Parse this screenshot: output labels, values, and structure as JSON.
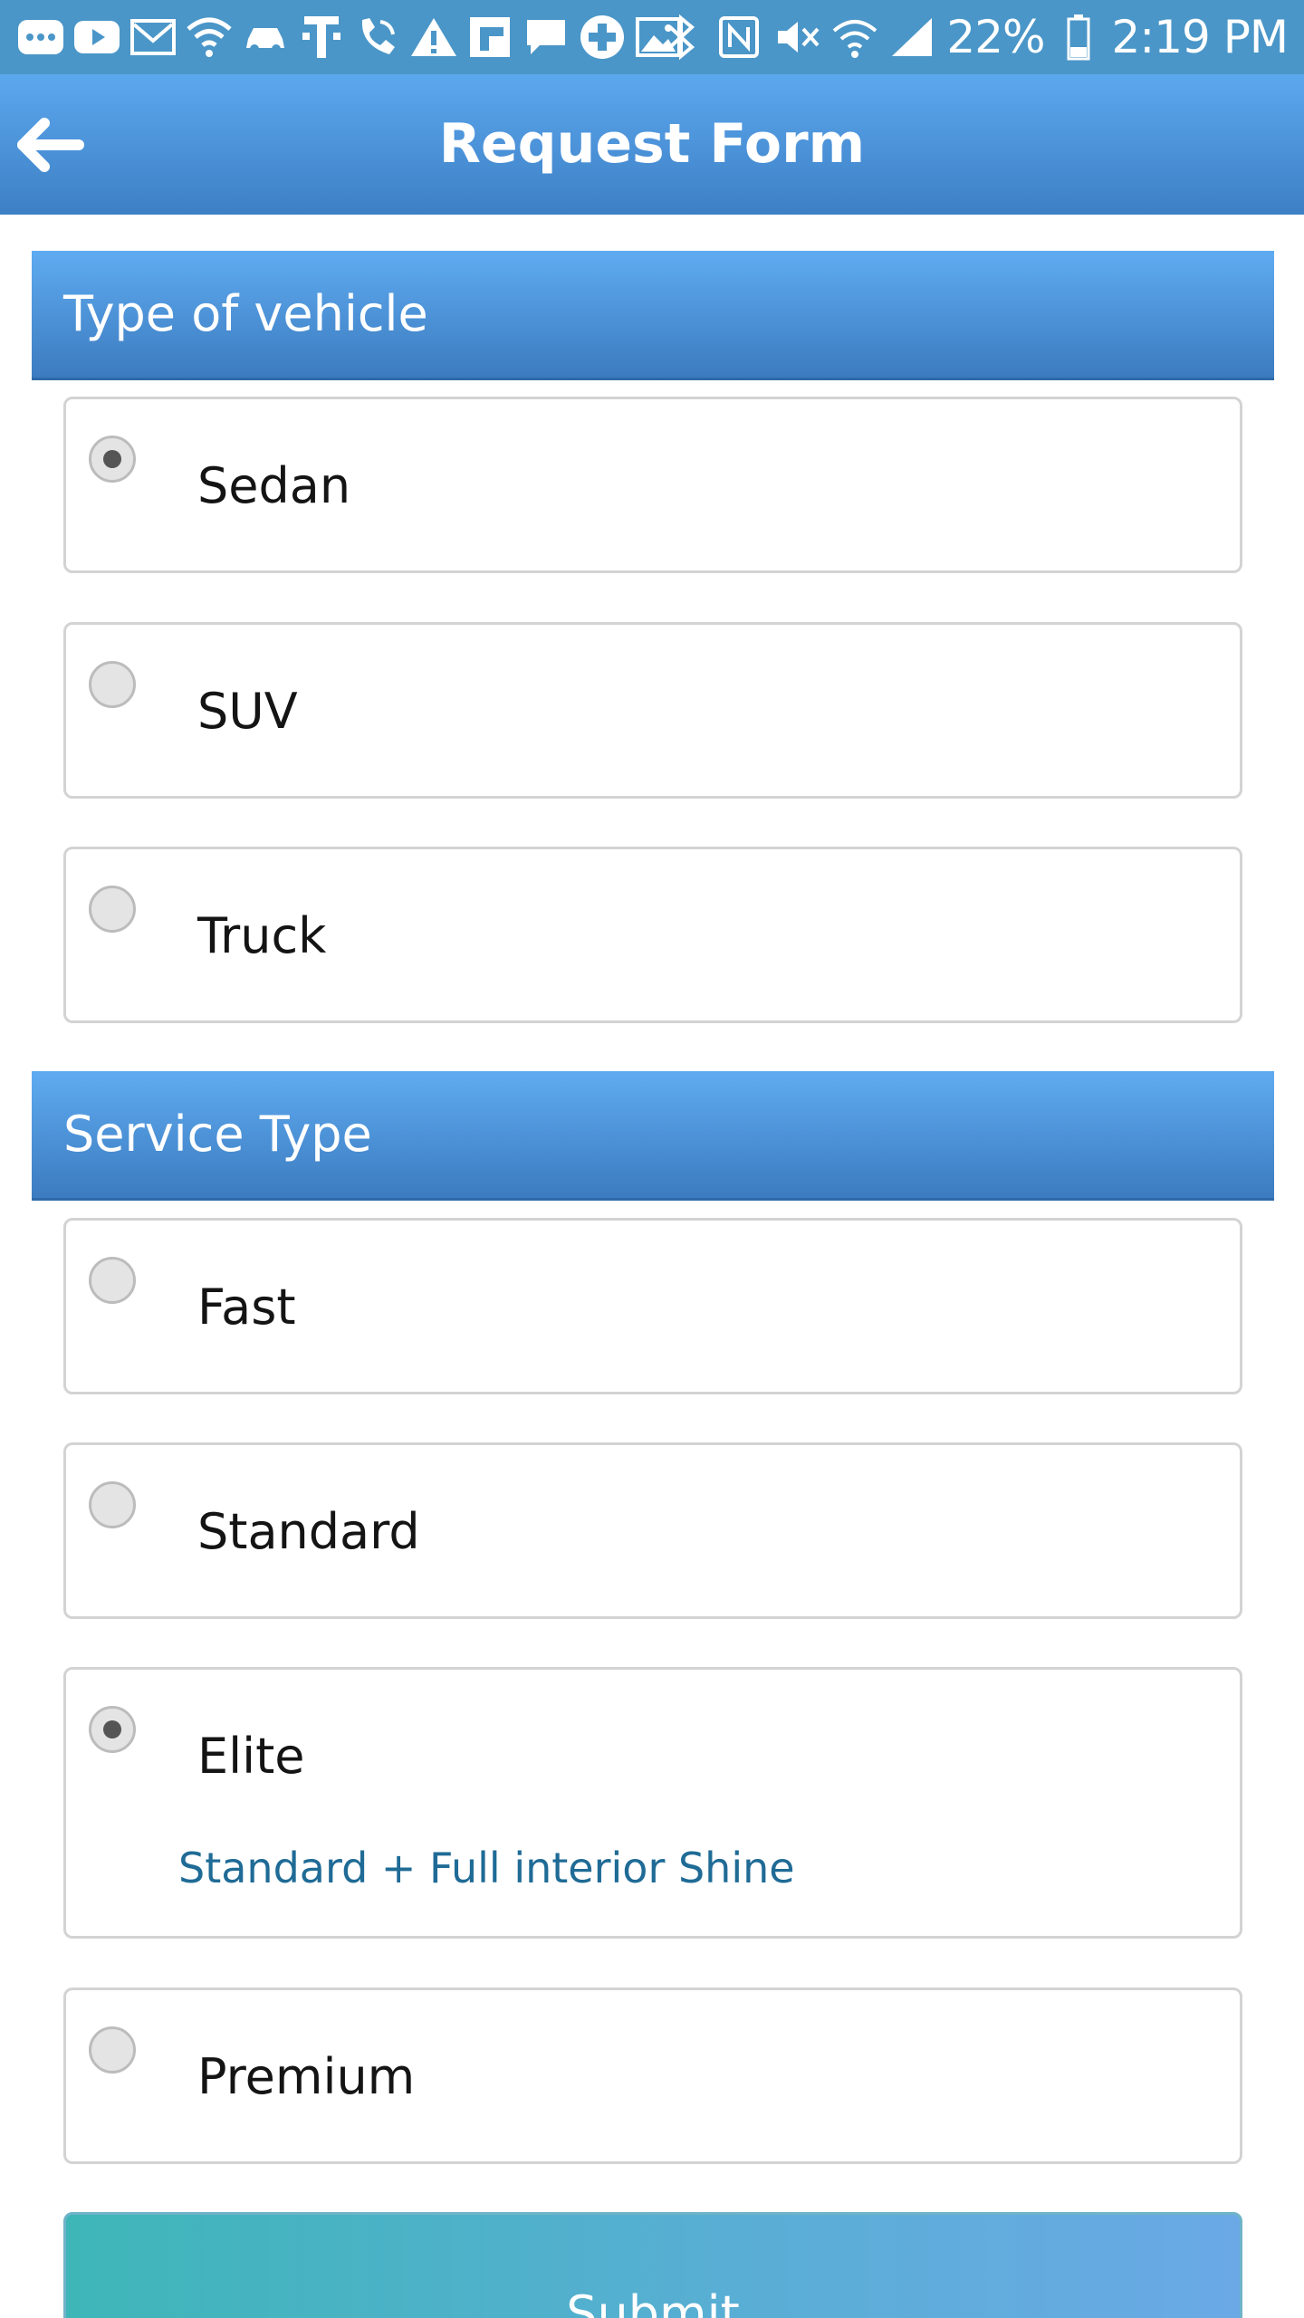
{
  "status_bar": {
    "icons": [
      "more-icon",
      "youtube-icon",
      "mail-icon",
      "shield-wifi-icon",
      "car-icon",
      "t-mobile-icon",
      "wifi-call-icon",
      "warning-icon",
      "flipboard-icon",
      "message-icon",
      "plus-icon",
      "image-icon",
      "bluetooth-icon",
      "nfc-icon",
      "mute-icon",
      "wifi-icon",
      "signal-icon",
      "battery-icon"
    ],
    "battery": "22%",
    "time": "2:19 PM"
  },
  "app_bar": {
    "title": "Request Form",
    "back_icon": "arrow-left-icon"
  },
  "vehicle_section": {
    "title": "Type of vehicle",
    "options": [
      {
        "label": "Sedan",
        "selected": true
      },
      {
        "label": "SUV",
        "selected": false
      },
      {
        "label": "Truck",
        "selected": false
      }
    ]
  },
  "service_section": {
    "title": "Service Type",
    "options": [
      {
        "label": "Fast",
        "selected": false
      },
      {
        "label": "Standard",
        "selected": false
      },
      {
        "label": "Elite",
        "selected": true,
        "description": "Standard + Full interior Shine"
      },
      {
        "label": "Premium",
        "selected": false
      }
    ]
  },
  "submit": {
    "label": "Submit"
  },
  "colors": {
    "status_bar": "#4a96c8",
    "header_blue": "#4f95dc",
    "description_text": "#1f6b96",
    "submit_teal": "#3eb6b8"
  }
}
